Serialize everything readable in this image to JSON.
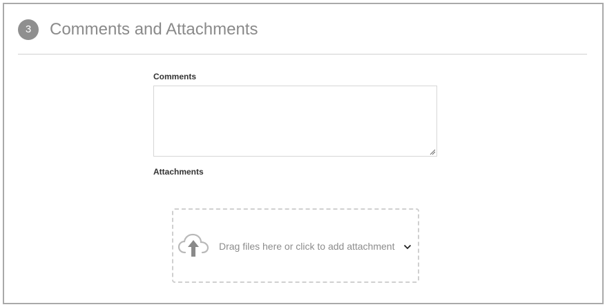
{
  "section": {
    "step_number": "3",
    "title": "Comments and Attachments"
  },
  "comments": {
    "label": "Comments",
    "value": ""
  },
  "attachments": {
    "label": "Attachments",
    "dropzone_text": "Drag files here or click to add attachment",
    "upload_icon": "cloud-upload-icon",
    "menu_icon": "chevron-down-icon"
  },
  "colors": {
    "border": "#a9a9a9",
    "badge": "#8f8f8f",
    "title": "#8a8a8a",
    "dashed": "#cfcfcf"
  }
}
